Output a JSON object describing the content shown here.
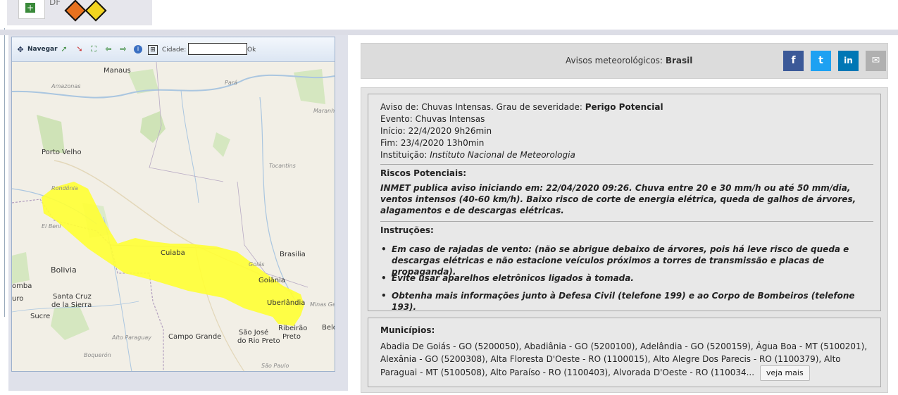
{
  "top": {
    "state_code": "DF"
  },
  "map": {
    "nav_label": "Navegar",
    "city_label": "Cidade:",
    "city_value": "",
    "ok_label": "Ok",
    "places": {
      "manaus": "Manaus",
      "amazonas": "Amazonas",
      "para": "Pará",
      "maranhao": "Maranh",
      "porto_velho": "Porto Velho",
      "rondonia": "Rondônia",
      "tocantins": "Tocantins",
      "el_beni": "El Beni",
      "cuiaba": "Cuiaba",
      "brasilia": "Brasilia",
      "goias": "Goiás",
      "goiania": "Goiânia",
      "bolivia": "Bolivia",
      "santa_cruz": "Santa Cruz",
      "de_la_sierra": "de la Sierra",
      "uberlandia": "Uberlândia",
      "minas_ge": "Minas Ge",
      "sucre": "Sucre",
      "alto_paraguay": "Alto Paraguay",
      "campo_grande": "Campo Grande",
      "sao_jose": "São José",
      "do_rio_preto": "do Rio Preto",
      "ribeirao": "Ribeirão",
      "preto": "Preto",
      "boqueron": "Boquerón",
      "sao_paulo": "São Paulo",
      "urro": "uro",
      "omba": "omba",
      "belo": "Belo"
    }
  },
  "header": {
    "title_prefix": "Avisos meteorológicos:",
    "title_region": "Brasil"
  },
  "social": {
    "facebook": "f",
    "twitter": "t",
    "linkedin": "in",
    "email": "✉"
  },
  "alert": {
    "aviso_prefix": "Aviso de: Chuvas Intensas. Grau de severidade:",
    "severity": "Perigo Potencial",
    "evento": "Evento: Chuvas Intensas",
    "inicio": "Início: 22/4/2020 9h26min",
    "fim": "Fim: 23/4/2020 13h0min",
    "instituicao_label": "Instituição:",
    "instituicao": "Instituto Nacional de Meteorologia",
    "riscos_heading": "Riscos Potenciais:",
    "riscos_text": "INMET publica aviso iniciando em: 22/04/2020 09:26. Chuva entre 20 e 30 mm/h ou até 50 mm/dia, ventos intensos (40-60 km/h). Baixo risco de corte de energia elétrica, queda de galhos de árvores, alagamentos e de descargas elétricas.",
    "instrucoes_heading": "Instruções:",
    "instrucoes": [
      "Em caso de rajadas de vento: (não se abrigue debaixo de árvores, pois há leve risco de queda e descargas elétricas e não estacione veículos próximos a torres de transmissão e placas de propaganda).",
      "Evite usar aparelhos eletrônicos ligados à tomada.",
      "Obtenha mais informações junto à Defesa Civil (telefone 199) e ao Corpo de Bombeiros (telefone 193)."
    ]
  },
  "municipios": {
    "heading": "Municípios:",
    "text": "Abadia De Goiás - GO (5200050), Abadiânia - GO (5200100), Adelândia - GO (5200159), Água Boa - MT (5100201), Alexânia - GO (5200308), Alta Floresta D'Oeste - RO (1100015), Alto Alegre Dos Parecis - RO (1100379), Alto Paraguai - MT (5100508), Alto Paraíso - RO (1100403), Alvorada D'Oeste - RO (110034...",
    "see_more": "veja mais"
  },
  "colors": {
    "alert_area": "#ffff33",
    "facebook": "#3b5998",
    "twitter": "#1da1f2",
    "linkedin": "#0077b5",
    "email": "#b0b0b0"
  }
}
